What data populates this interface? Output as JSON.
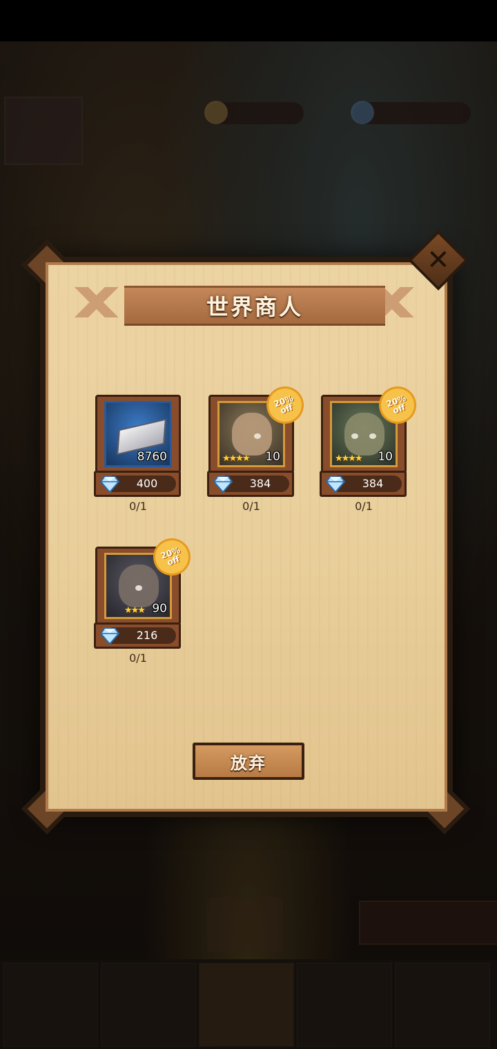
{
  "dialog": {
    "title": "世界商人",
    "close_glyph": "✕",
    "giveup_label": "放弃"
  },
  "items": [
    {
      "kind": "material",
      "quantity": "8760",
      "price": "400",
      "limit": "0/1",
      "discount": ""
    },
    {
      "kind": "hero",
      "stars": "★★★★",
      "level": "10",
      "price": "384",
      "limit": "0/1",
      "discount": "20%\noff"
    },
    {
      "kind": "hero",
      "stars": "★★★★",
      "level": "10",
      "price": "384",
      "limit": "0/1",
      "discount": "20%\noff"
    },
    {
      "kind": "hero",
      "stars": "★★★",
      "level": "90",
      "price": "216",
      "limit": "0/1",
      "discount": "20%\noff"
    }
  ],
  "icons": {
    "gem": "diamond-icon",
    "close": "close-icon"
  },
  "colors": {
    "panel": "#e9cf9b",
    "frame": "#2a1b10",
    "accent": "#a56a3f",
    "badge": "#f6c24a"
  }
}
